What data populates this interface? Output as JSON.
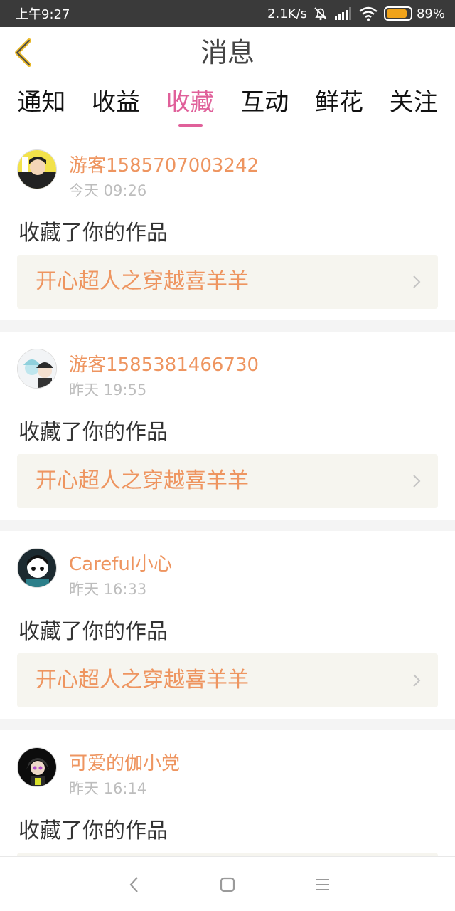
{
  "status_bar": {
    "time": "上午9:27",
    "net_speed": "2.1K/s",
    "battery_percent": "89%",
    "battery_level": 0.89,
    "icons": [
      "mute-bell-icon",
      "signal-icon",
      "wifi-icon",
      "battery-icon"
    ]
  },
  "header": {
    "title": "消息",
    "back_icon": "chevron-left-icon",
    "accent": "#e0609a"
  },
  "tabs": [
    {
      "label": "通知",
      "active": false
    },
    {
      "label": "收益",
      "active": false
    },
    {
      "label": "收藏",
      "active": true
    },
    {
      "label": "互动",
      "active": false
    },
    {
      "label": "鲜花",
      "active": false
    },
    {
      "label": "关注",
      "active": false
    }
  ],
  "items": [
    {
      "user": "游客1585707003242",
      "time": "今天 09:26",
      "action": "收藏了你的作品",
      "work": "开心超人之穿越喜羊羊"
    },
    {
      "user": "游客1585381466730",
      "time": "昨天 19:55",
      "action": "收藏了你的作品",
      "work": "开心超人之穿越喜羊羊"
    },
    {
      "user": "Careful小心",
      "time": "昨天 16:33",
      "action": "收藏了你的作品",
      "work": "开心超人之穿越喜羊羊"
    },
    {
      "user": "可爱的伽小党",
      "time": "昨天 16:14",
      "action": "收藏了你的作品",
      "work": ""
    }
  ],
  "colors": {
    "username": "#ee9560",
    "work_title": "#ee9560",
    "time": "#bdbdbd",
    "status_bar_bg": "#3a3a3a"
  },
  "nav_bar": {
    "icons": [
      "back-icon",
      "home-icon",
      "menu-icon"
    ]
  }
}
